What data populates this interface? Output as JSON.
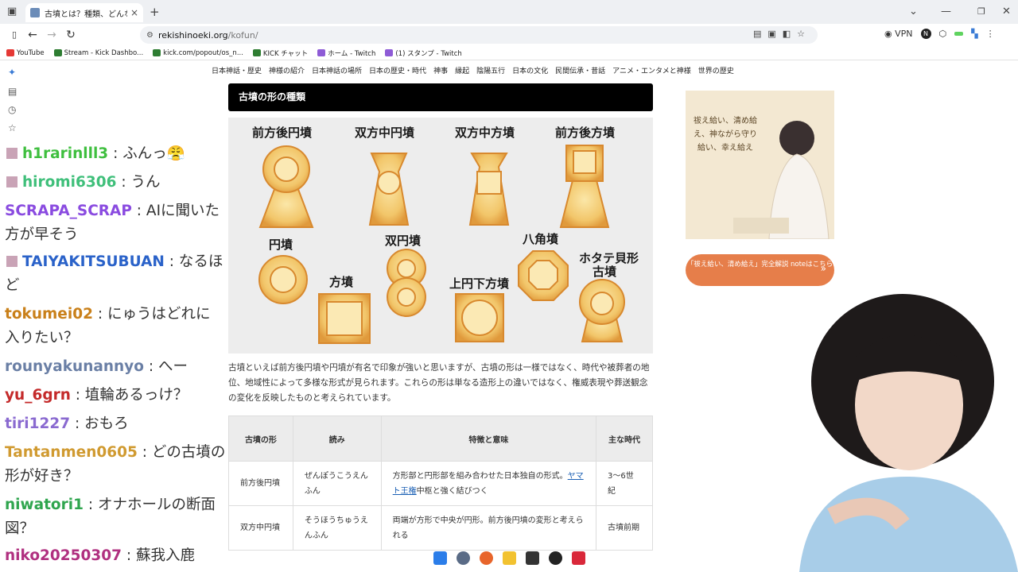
{
  "browser": {
    "tab_title": "古墳とは？種類、どんな風に作り、",
    "url_host": "rekishinoeki.org",
    "url_path": "/kofun/",
    "vpn_label": "VPN",
    "profile_letter": "N"
  },
  "bookmarks": [
    {
      "label": "YouTube",
      "color": "#e53935"
    },
    {
      "label": "Stream - Kick Dashbo...",
      "color": "#2e7d32"
    },
    {
      "label": "kick.com/popout/os_n...",
      "color": "#2e7d32"
    },
    {
      "label": "KICK チャット",
      "color": "#2e7d32"
    },
    {
      "label": "ホーム - Twitch",
      "color": "#8e5bd6"
    },
    {
      "label": "(1) スタンプ - Twitch",
      "color": "#8e5bd6"
    }
  ],
  "menu": [
    "日本神話・歴史",
    "神様の紹介",
    "日本神話の場所",
    "日本の歴史・時代",
    "神事",
    "縁起",
    "陰陽五行",
    "日本の文化",
    "民間伝承・昔話",
    "アニメ・エンタメと神様",
    "世界の歴史"
  ],
  "section_title": "古墳の形の種類",
  "figure_labels": {
    "zenpo_koen": "前方後円墳",
    "soho_chuen": "双方中円墳",
    "soho_chuho": "双方中方墳",
    "zenpo_koho": "前方後方墳",
    "enpun": "円墳",
    "sohun": "方墳",
    "soen": "双円墳",
    "hakkaku": "八角墳",
    "jouen_kaho": "上円下方墳",
    "hotate_1": "ホタテ貝形",
    "hotate_2": "古墳"
  },
  "paragraph": "古墳といえば前方後円墳や円墳が有名で印象が強いと思いますが、古墳の形は一様ではなく、時代や被葬者の地位、地域性によって多様な形式が見られます。これらの形は単なる造形上の違いではなく、権威表現や葬送観念の変化を反映したものと考えられています。",
  "table": {
    "headers": [
      "古墳の形",
      "読み",
      "特徴と意味",
      "主な時代"
    ],
    "rows": [
      {
        "shape": "前方後円墳",
        "reading": "ぜんぽうこうえんふん",
        "feature_pre": "方形部と円形部を組み合わせた日本独自の形式。",
        "feature_link": "ヤマト王権",
        "feature_post": "中枢と強く結びつく",
        "era": "3〜6世紀"
      },
      {
        "shape": "双方中円墳",
        "reading": "そうほうちゅうえんふん",
        "feature_pre": "両端が方形で中央が円形。前方後円墳の変形と考えられる",
        "feature_link": "",
        "feature_post": "",
        "era": "古墳前期"
      }
    ]
  },
  "ad": {
    "text": "祓え給い、清め給え、神ながら守り給い、幸え給え",
    "cta": "「祓え給い、清め給え」完全解説 noteはこちら",
    "cta_arrow": "»"
  },
  "chat": [
    {
      "user": "h1rarinlll3",
      "text": "ふんっ😤",
      "color": "#3fbf3f",
      "avatar": true
    },
    {
      "user": "hiromi6306",
      "text": "うん",
      "color": "#3fbf7a",
      "avatar": true
    },
    {
      "user": "SCRAPA_SCRAP",
      "text": "AIに聞いた",
      "color": "#8a4be0",
      "avatar": false
    },
    {
      "user": "",
      "text": "方が早そう",
      "color": "#333",
      "avatar": false
    },
    {
      "user": "TAIYAKITSUBUAN",
      "text": "なるほ",
      "color": "#2a62c9",
      "avatar": true
    },
    {
      "user": "",
      "text": "ど",
      "color": "#333",
      "avatar": false
    },
    {
      "user": "tokumei02",
      "text": "にゅうはどれに",
      "color": "#c9801a",
      "avatar": false
    },
    {
      "user": "",
      "text": "入りたい？",
      "color": "#333",
      "avatar": false
    },
    {
      "user": "rounyakunannyo",
      "text": "へー",
      "color": "#6a7fa5",
      "avatar": false
    },
    {
      "user": "yu_6grn",
      "text": "埴輪あるっけ？",
      "color": "#c42a2a",
      "avatar": false
    },
    {
      "user": "tiri1227",
      "text": "おもろ",
      "color": "#8a6ad0",
      "avatar": false
    },
    {
      "user": "Tantanmen0605",
      "text": "どの古墳の",
      "color": "#d09a30",
      "avatar": false
    },
    {
      "user": "",
      "text": "形が好き？",
      "color": "#333",
      "avatar": false
    },
    {
      "user": "niwatori1",
      "text": "オナホールの断面",
      "color": "#2fa54e",
      "avatar": false
    },
    {
      "user": "",
      "text": "図？",
      "color": "#333",
      "avatar": false
    },
    {
      "user": "niko20250307",
      "text": "蘇我入鹿",
      "color": "#b03080",
      "avatar": false
    }
  ]
}
